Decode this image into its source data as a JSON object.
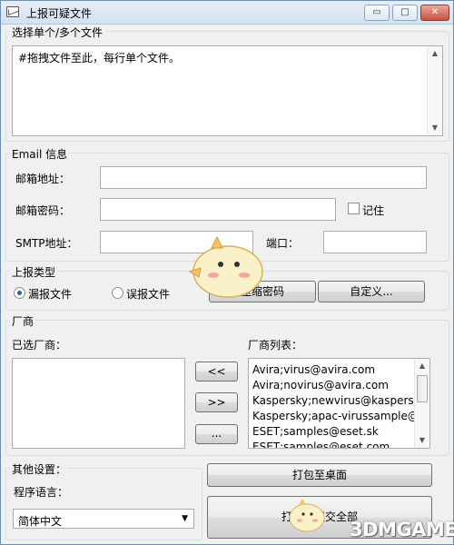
{
  "window": {
    "title": "上报可疑文件",
    "controls": {
      "minimize": "▭",
      "maximize": "□",
      "close": "✕"
    }
  },
  "files": {
    "group_label": "选择单个/多个文件",
    "textarea_value": "#拖拽文件至此，每行单个文件。"
  },
  "email": {
    "group_label": "Email 信息",
    "address_label": "邮箱地址：",
    "address_value": "",
    "password_label": "邮箱密码：",
    "password_value": "",
    "remember_label": "记住",
    "remember_checked": false,
    "smtp_label": "SMTP地址：",
    "smtp_value": "",
    "port_label": "端口：",
    "port_value": ""
  },
  "report_type": {
    "group_label": "上报类型",
    "missed_label": "漏报文件",
    "missed_selected": true,
    "false_label": "误报文件",
    "false_selected": false,
    "compress_password_button": "压缩密码",
    "custom_button": "自定义..."
  },
  "vendors": {
    "group_label": "厂商",
    "selected_label": "已选厂商：",
    "selected_items": [],
    "list_label": "厂商列表：",
    "add_button": "<<",
    "remove_button": ">>",
    "more_button": "...",
    "list_items": [
      "Avira;virus@avira.com",
      "Avira;novirus@avira.com",
      "Kaspersky;newvirus@kaspersk",
      "Kaspersky;apac-virussample@",
      "ESET;samples@eset.sk",
      "ESET;samples@eset.com"
    ]
  },
  "other": {
    "group_label": "其他设置：",
    "language_label": "程序语言：",
    "language_value": "简体中文",
    "pack_button": "打包至桌面",
    "submit_all_button": "打包并提交全部"
  },
  "watermark": "3DMGAME",
  "icons": {
    "app": "app-window-icon",
    "mascot": "chick-mascot-icon"
  }
}
